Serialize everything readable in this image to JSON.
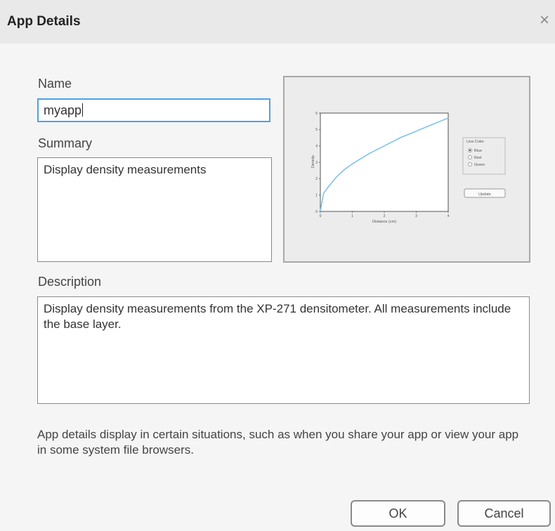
{
  "dialog": {
    "title": "App Details",
    "close_symbol": "×"
  },
  "form": {
    "name_label": "Name",
    "name_value": "myapp",
    "summary_label": "Summary",
    "summary_value": "Display density measurements",
    "description_label": "Description",
    "description_value": "Display density measurements from the XP-271 densitometer. All measurements include the base layer."
  },
  "preview": {
    "ylabel": "Density",
    "xlabel": "Distance (cm)",
    "y_ticks": [
      "0",
      "1",
      "2",
      "3",
      "4",
      "5",
      "6"
    ],
    "x_ticks": [
      "0",
      "1",
      "2",
      "3",
      "4"
    ],
    "line_color_title": "Line Color",
    "radio_options": [
      "Blue",
      "Red",
      "Green"
    ],
    "selected_option": "Blue",
    "update_button": "Update",
    "curve_color": "#7ec3ea",
    "chart_data": {
      "type": "line",
      "x": [
        0,
        0.1,
        0.25,
        0.5,
        0.75,
        1,
        1.5,
        2,
        2.5,
        3,
        3.5,
        4
      ],
      "y": [
        0,
        1.1,
        1.5,
        2.1,
        2.55,
        2.9,
        3.5,
        4.0,
        4.5,
        4.9,
        5.3,
        5.7
      ],
      "xlim": [
        0,
        4
      ],
      "ylim": [
        0,
        6
      ],
      "xlabel": "Distance (cm)",
      "ylabel": "Density"
    }
  },
  "footer": {
    "note": "App details display in certain situations, such as when you share your app or view your app in some system file browsers.",
    "ok_label": "OK",
    "cancel_label": "Cancel"
  },
  "colors": {
    "focus_border": "#4aa3e8",
    "titlebar_bg": "#e9e9e9",
    "dialog_bg": "#f5f5f5"
  }
}
